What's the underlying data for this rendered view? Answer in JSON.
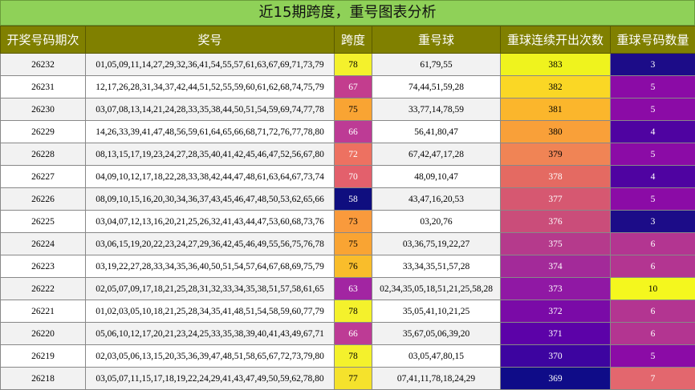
{
  "title": "近15期跨度，重号图表分析",
  "headers": [
    "开奖号码期次",
    "奖号",
    "跨度",
    "重号球",
    "重球连续开出次数",
    "重球号码数量"
  ],
  "rows": [
    {
      "period": "26232",
      "numbers": "01,05,09,11,14,27,29,32,36,41,54,55,57,61,63,67,69,71,73,79",
      "span": "78",
      "repeat": "61,79,55",
      "streak": "383",
      "count": "3"
    },
    {
      "period": "26231",
      "numbers": "12,17,26,28,31,34,37,42,44,51,52,55,59,60,61,62,68,74,75,79",
      "span": "67",
      "repeat": "74,44,51,59,28",
      "streak": "382",
      "count": "5"
    },
    {
      "period": "26230",
      "numbers": "03,07,08,13,14,21,24,28,33,35,38,44,50,51,54,59,69,74,77,78",
      "span": "75",
      "repeat": "33,77,14,78,59",
      "streak": "381",
      "count": "5"
    },
    {
      "period": "26229",
      "numbers": "14,26,33,39,41,47,48,56,59,61,64,65,66,68,71,72,76,77,78,80",
      "span": "66",
      "repeat": "56,41,80,47",
      "streak": "380",
      "count": "4"
    },
    {
      "period": "26228",
      "numbers": "08,13,15,17,19,23,24,27,28,35,40,41,42,45,46,47,52,56,67,80",
      "span": "72",
      "repeat": "67,42,47,17,28",
      "streak": "379",
      "count": "5"
    },
    {
      "period": "26227",
      "numbers": "04,09,10,12,17,18,22,28,33,38,42,44,47,48,61,63,64,67,73,74",
      "span": "70",
      "repeat": "48,09,10,47",
      "streak": "378",
      "count": "4"
    },
    {
      "period": "26226",
      "numbers": "08,09,10,15,16,20,30,34,36,37,43,45,46,47,48,50,53,62,65,66",
      "span": "58",
      "repeat": "43,47,16,20,53",
      "streak": "377",
      "count": "5"
    },
    {
      "period": "26225",
      "numbers": "03,04,07,12,13,16,20,21,25,26,32,41,43,44,47,53,60,68,73,76",
      "span": "73",
      "repeat": "03,20,76",
      "streak": "376",
      "count": "3"
    },
    {
      "period": "26224",
      "numbers": "03,06,15,19,20,22,23,24,27,29,36,42,45,46,49,55,56,75,76,78",
      "span": "75",
      "repeat": "03,36,75,19,22,27",
      "streak": "375",
      "count": "6"
    },
    {
      "period": "26223",
      "numbers": "03,19,22,27,28,33,34,35,36,40,50,51,54,57,64,67,68,69,75,79",
      "span": "76",
      "repeat": "33,34,35,51,57,28",
      "streak": "374",
      "count": "6"
    },
    {
      "period": "26222",
      "numbers": "02,05,07,09,17,18,21,25,28,31,32,33,34,35,38,51,57,58,61,65",
      "span": "63",
      "repeat": "02,34,35,05,18,51,21,25,58,28",
      "streak": "373",
      "count": "10"
    },
    {
      "period": "26221",
      "numbers": "01,02,03,05,10,18,21,25,28,34,35,41,48,51,54,58,59,60,77,79",
      "span": "78",
      "repeat": "35,05,41,10,21,25",
      "streak": "372",
      "count": "6"
    },
    {
      "period": "26220",
      "numbers": "05,06,10,12,17,20,21,23,24,25,33,35,38,39,40,41,43,49,67,71",
      "span": "66",
      "repeat": "35,67,05,06,39,20",
      "streak": "371",
      "count": "6"
    },
    {
      "period": "26219",
      "numbers": "02,03,05,06,13,15,20,35,36,39,47,48,51,58,65,67,72,73,79,80",
      "span": "78",
      "repeat": "03,05,47,80,15",
      "streak": "370",
      "count": "5"
    },
    {
      "period": "26218",
      "numbers": "03,05,07,11,15,17,18,19,22,24,29,41,43,47,49,50,59,62,78,80",
      "span": "77",
      "repeat": "07,41,11,78,18,24,29",
      "streak": "369",
      "count": "7"
    }
  ],
  "colors": {
    "span": [
      "#f4f12c",
      "#c33d8e",
      "#f9a433",
      "#bd3b95",
      "#ed7161",
      "#e3606c",
      "#0f0e7f",
      "#f99a3c",
      "#f9a433",
      "#f9bd2b",
      "#a225a2",
      "#f4f12c",
      "#bd3b95",
      "#f4f12c",
      "#f5e22c"
    ],
    "streak": [
      "#eff31e",
      "#fad725",
      "#fbb62c",
      "#f9a039",
      "#f08455",
      "#e46a62",
      "#d65871",
      "#ca4d7a",
      "#b53a8c",
      "#a32a99",
      "#9018a4",
      "#7a0aa7",
      "#5c02a8",
      "#3d04a0",
      "#0f0c88"
    ],
    "count": [
      "#1c0c88",
      "#8b0ba6",
      "#8b0ba6",
      "#4f03a1",
      "#8b0ba6",
      "#4f03a1",
      "#8b0ba6",
      "#1c0c88",
      "#b33591",
      "#b33591",
      "#f4f71e",
      "#b33591",
      "#b33591",
      "#8b0ba6",
      "#e3676e"
    ]
  }
}
